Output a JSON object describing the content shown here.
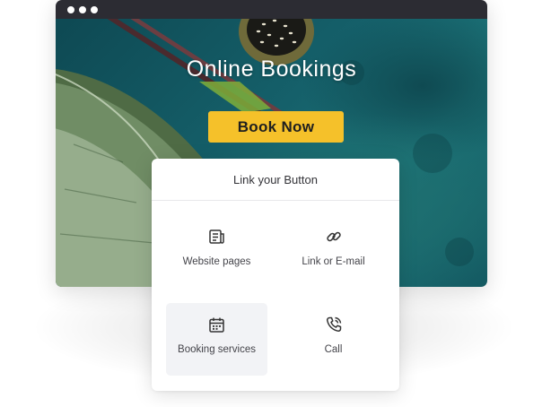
{
  "hero": {
    "title": "Online Bookings",
    "button_label": "Book Now",
    "button_color": "#f5c12a"
  },
  "panel": {
    "title": "Link your Button",
    "options": [
      {
        "label": "Website pages",
        "icon": "website-pages-icon"
      },
      {
        "label": "Link or E-mail",
        "icon": "link-icon"
      },
      {
        "label": "Booking services",
        "icon": "calendar-icon",
        "selected": true
      },
      {
        "label": "Call",
        "icon": "phone-icon"
      }
    ]
  }
}
